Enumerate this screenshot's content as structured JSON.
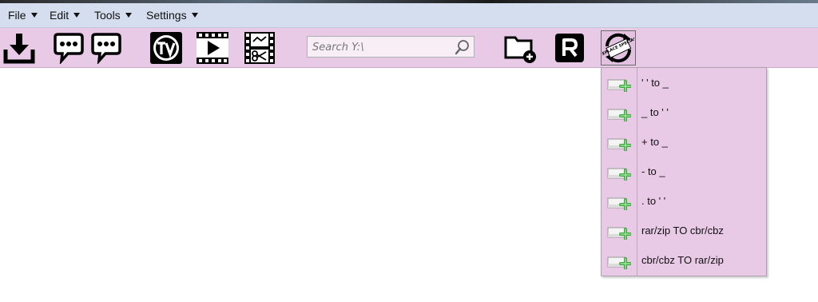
{
  "menubar": {
    "items": [
      {
        "label": "File"
      },
      {
        "label": "Edit"
      },
      {
        "label": "Tools"
      },
      {
        "label": "Settings"
      }
    ]
  },
  "toolbar": {
    "buttons": [
      {
        "icon": "download-icon"
      },
      {
        "icon": "speech-bubble-icon"
      },
      {
        "icon": "speech-bubble-icon"
      },
      {
        "icon": "tv-icon"
      },
      {
        "icon": "video-play-icon"
      },
      {
        "icon": "film-cut-icon"
      },
      {
        "icon": "new-folder-icon"
      },
      {
        "icon": "rename-r-icon"
      },
      {
        "icon": "replace-special-icon",
        "text": "REPLACE SPECIAL"
      }
    ],
    "search": {
      "placeholder": "Search Y:\\",
      "value": ""
    }
  },
  "replace_menu": {
    "items": [
      {
        "label": "' ' to _"
      },
      {
        "label": "_ to ' '"
      },
      {
        "label": "+ to _"
      },
      {
        "label": "- to _"
      },
      {
        "label": ". to ' '"
      },
      {
        "label": "rar/zip TO cbr/cbz"
      },
      {
        "label": "cbr/cbz TO rar/zip"
      }
    ]
  },
  "colors": {
    "menubar": "#d5deef",
    "toolbar": "#e8c9e6",
    "icon_plus": "#3aa83a"
  }
}
